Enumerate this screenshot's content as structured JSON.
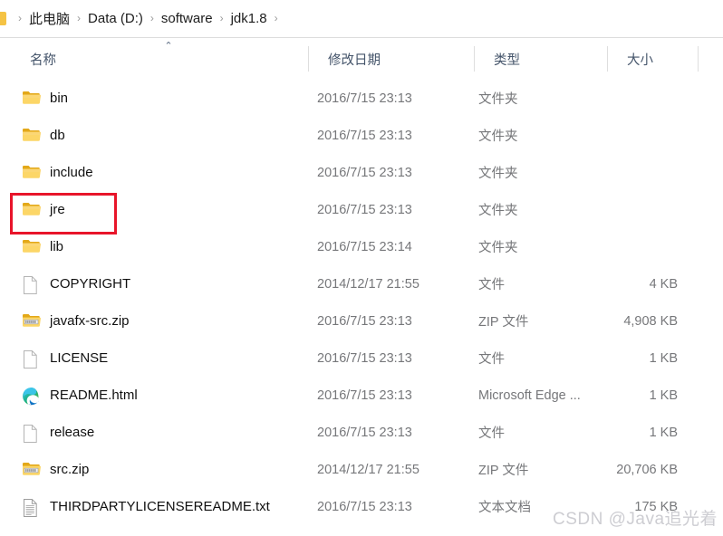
{
  "window": {
    "app": "Windows File Explorer"
  },
  "breadcrumb": {
    "root_icon": "folder-icon",
    "separator": "›",
    "items": [
      {
        "label": "此电脑"
      },
      {
        "label": "Data (D:)"
      },
      {
        "label": "software"
      },
      {
        "label": "jdk1.8"
      }
    ]
  },
  "columns": {
    "name": "名称",
    "date_modified": "修改日期",
    "type": "类型",
    "size": "大小",
    "sort_indicator": "⌃"
  },
  "files": [
    {
      "name": "bin",
      "icon": "folder-icon",
      "date": "2016/7/15 23:13",
      "type": "文件夹",
      "size": ""
    },
    {
      "name": "db",
      "icon": "folder-icon",
      "date": "2016/7/15 23:13",
      "type": "文件夹",
      "size": ""
    },
    {
      "name": "include",
      "icon": "folder-icon",
      "date": "2016/7/15 23:13",
      "type": "文件夹",
      "size": ""
    },
    {
      "name": "jre",
      "icon": "folder-icon",
      "date": "2016/7/15 23:13",
      "type": "文件夹",
      "size": ""
    },
    {
      "name": "lib",
      "icon": "folder-icon",
      "date": "2016/7/15 23:14",
      "type": "文件夹",
      "size": ""
    },
    {
      "name": "COPYRIGHT",
      "icon": "blank-document-icon",
      "date": "2014/12/17 21:55",
      "type": "文件",
      "size": "4 KB"
    },
    {
      "name": "javafx-src.zip",
      "icon": "zip-folder-icon",
      "date": "2016/7/15 23:13",
      "type": "ZIP 文件",
      "size": "4,908 KB"
    },
    {
      "name": "LICENSE",
      "icon": "blank-document-icon",
      "date": "2016/7/15 23:13",
      "type": "文件",
      "size": "1 KB"
    },
    {
      "name": "README.html",
      "icon": "microsoft-edge-icon",
      "date": "2016/7/15 23:13",
      "type": "Microsoft Edge ...",
      "size": "1 KB"
    },
    {
      "name": "release",
      "icon": "blank-document-icon",
      "date": "2016/7/15 23:13",
      "type": "文件",
      "size": "1 KB"
    },
    {
      "name": "src.zip",
      "icon": "zip-folder-icon",
      "date": "2014/12/17 21:55",
      "type": "ZIP 文件",
      "size": "20,706 KB"
    },
    {
      "name": "THIRDPARTYLICENSEREADME.txt",
      "icon": "text-document-icon",
      "date": "2016/7/15 23:13",
      "type": "文本文档",
      "size": "175 KB"
    }
  ],
  "annotation": {
    "target_row_name": "jre",
    "color": "#e8152a"
  },
  "watermark": {
    "text": "CSDN @Java追光着",
    "color": "#cdcdd2"
  }
}
